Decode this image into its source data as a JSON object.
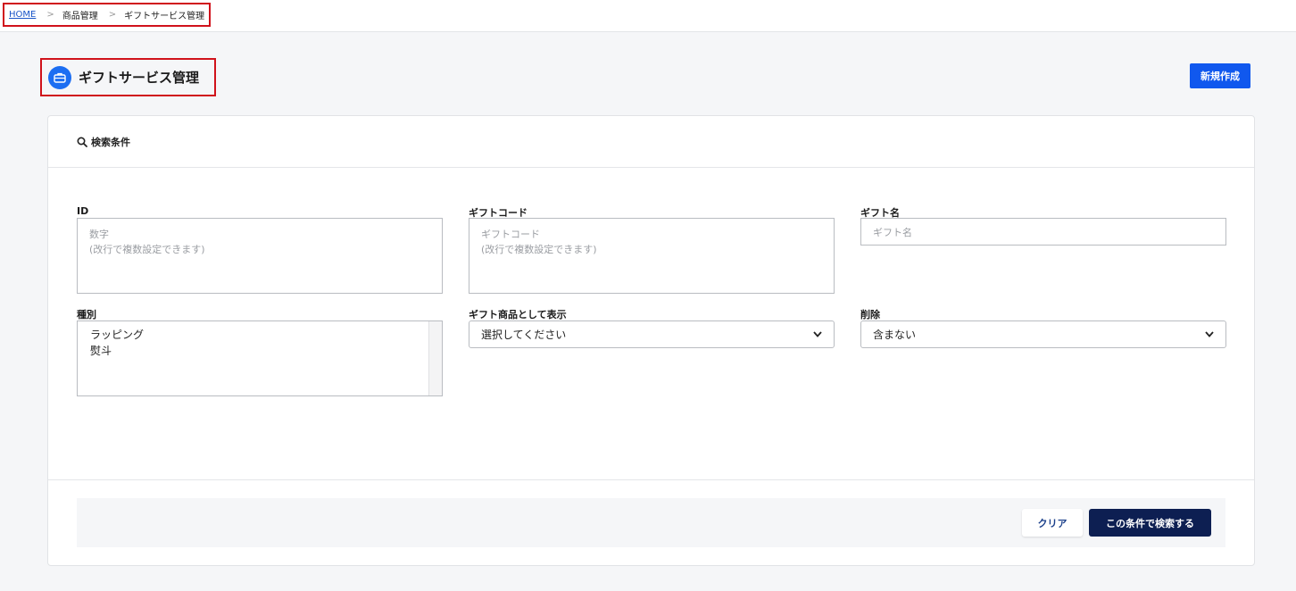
{
  "breadcrumb": {
    "home": "HOME",
    "separator": ">",
    "level1": "商品管理",
    "level2": "ギフトサービス管理"
  },
  "header": {
    "title": "ギフトサービス管理",
    "icon": "briefcase-icon",
    "new_button": "新規作成"
  },
  "search": {
    "heading": "検索条件",
    "id": {
      "label": "ID",
      "placeholder": "数字\n(改行で複数設定できます)"
    },
    "gift_code": {
      "label": "ギフトコード",
      "placeholder": "ギフトコード\n(改行で複数設定できます)"
    },
    "gift_name": {
      "label": "ギフト名",
      "placeholder": "ギフト名"
    },
    "type": {
      "label": "種別",
      "options": [
        "ラッピング",
        "熨斗"
      ]
    },
    "display_as_gift": {
      "label": "ギフト商品として表示",
      "selected": "選択してください"
    },
    "deleted": {
      "label": "削除",
      "selected": "含まない"
    },
    "clear_button": "クリア",
    "submit_button": "この条件で検索する"
  },
  "colors": {
    "accent": "#1058ee",
    "primary_dark": "#0d1f52",
    "highlight_border": "#d0121b"
  }
}
